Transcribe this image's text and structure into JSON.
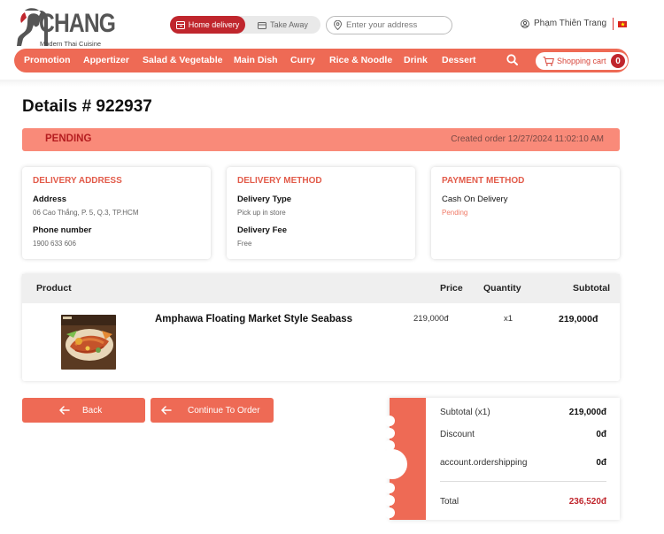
{
  "header": {
    "logo_text": "CHANG",
    "logo_subtitle": "Modern Thai Cuisine",
    "mode_home": "Home delivery",
    "mode_takeaway": "Take Away",
    "address_placeholder": "Enter your address",
    "user_name": "Phạm Thiên Trang"
  },
  "nav": {
    "items": [
      "Promotion",
      "Appertizer",
      "Salad & Vegetable",
      "Main Dish",
      "Curry",
      "Rice & Noodle",
      "Drink",
      "Dessert"
    ],
    "cart_label": "Shopping cart",
    "cart_count": "0"
  },
  "order": {
    "title": "Details # 922937",
    "status": "PENDING",
    "created": "Created order 12/27/2024 11:02:10 AM"
  },
  "delivery_address": {
    "title": "DELIVERY ADDRESS",
    "address_label": "Address",
    "address_value": "06 Cao Thắng, P. 5, Q.3, TP.HCM",
    "phone_label": "Phone number",
    "phone_value": "1900 633 606"
  },
  "delivery_method": {
    "title": "DELIVERY METHOD",
    "type_label": "Delivery Type",
    "type_value": "Pick up in store",
    "fee_label": "Delivery Fee",
    "fee_value": "Free"
  },
  "payment_method": {
    "title": "PAYMENT METHOD",
    "method": "Cash On Delivery",
    "status": "Pending"
  },
  "table": {
    "headers": {
      "product": "Product",
      "price": "Price",
      "quantity": "Quantity",
      "subtotal": "Subtotal"
    },
    "rows": [
      {
        "name": "Amphawa Floating Market Style Seabass",
        "price": "219,000đ",
        "quantity": "x1",
        "subtotal": "219,000đ"
      }
    ]
  },
  "buttons": {
    "back": "Back",
    "continue": "Continue To Order"
  },
  "summary": {
    "subtotal_label": "Subtotal (x1)",
    "subtotal_value": "219,000đ",
    "discount_label": "Discount",
    "discount_value": "0đ",
    "shipping_label": "account.ordershipping",
    "shipping_value": "0đ",
    "total_label": "Total",
    "total_value": "236,520đ"
  },
  "colors": {
    "brand": "#ee6a55",
    "brand_dark": "#c0262d",
    "status_bg": "#f98a79",
    "accent_text": "#e25b4a"
  }
}
